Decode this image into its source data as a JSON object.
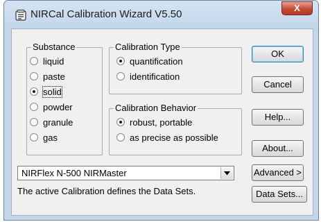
{
  "window": {
    "title": "NIRCal Calibration Wizard V5.50",
    "close_label": "X"
  },
  "substance": {
    "label": "Substance",
    "options": [
      "liquid",
      "paste",
      "solid",
      "powder",
      "granule",
      "gas"
    ],
    "selected": "solid"
  },
  "calibration_type": {
    "label": "Calibration Type",
    "options": [
      "quantification",
      "identification"
    ],
    "selected": "quantification"
  },
  "calibration_behavior": {
    "label": "Calibration Behavior",
    "options": [
      "robust, portable",
      "as precise as possible"
    ],
    "selected": "robust, portable"
  },
  "buttons": {
    "ok": "OK",
    "cancel": "Cancel",
    "help": "Help...",
    "about": "About...",
    "advanced": "Advanced >",
    "data_sets": "Data Sets..."
  },
  "instrument_select": {
    "value": "NIRFlex N-500 NIRMaster",
    "arrow_icon": "chevron-down-icon"
  },
  "status": {
    "text": "The active Calibration defines the Data Sets."
  },
  "colors": {
    "titlebar": "#c3d6ea",
    "client": "#f0f0f0",
    "close": "#c44a33"
  }
}
